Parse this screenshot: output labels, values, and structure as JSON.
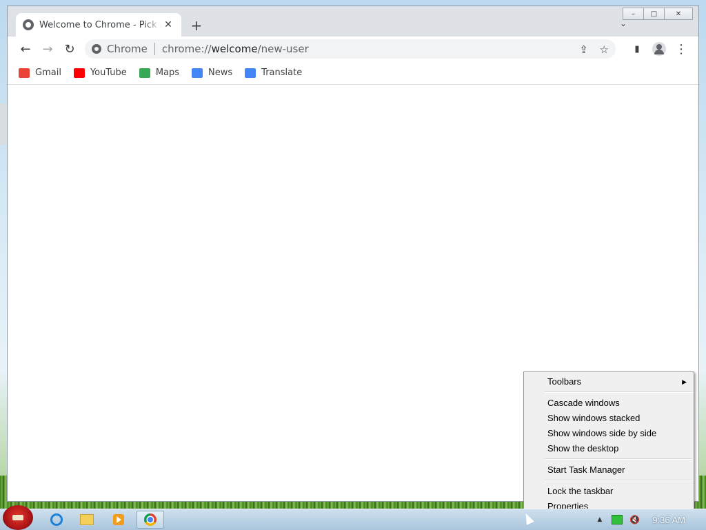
{
  "browser": {
    "tab": {
      "title": "Welcome to Chrome - Pick a b",
      "close": "✕",
      "icon": "chrome-page-icon"
    },
    "new_tab": "+",
    "tab_search": "⌄",
    "window_controls": {
      "minimize": "–",
      "maximize": "□",
      "close": "✕"
    },
    "nav": {
      "back": "←",
      "forward": "→",
      "reload": "↻"
    },
    "omnibox": {
      "chip": "Chrome",
      "url_scheme": "chrome://",
      "url_host": "welcome",
      "url_path": "/new-user"
    },
    "toolbar_icons": {
      "share": "⇪",
      "bookmark": "☆",
      "side_panel": "▮",
      "menu": "⋮"
    },
    "bookmarks": [
      {
        "label": "Gmail",
        "color": "#ea4335"
      },
      {
        "label": "YouTube",
        "color": "#ff0000"
      },
      {
        "label": "Maps",
        "color": "#34a853"
      },
      {
        "label": "News",
        "color": "#4285f4"
      },
      {
        "label": "Translate",
        "color": "#4285f4"
      }
    ]
  },
  "context_menu": {
    "items": [
      {
        "label": "Toolbars",
        "submenu": true
      },
      {
        "label": "Cascade windows"
      },
      {
        "label": "Show windows stacked"
      },
      {
        "label": "Show windows side by side"
      },
      {
        "label": "Show the desktop"
      },
      {
        "label": "Start Task Manager"
      },
      {
        "label": "Lock the taskbar"
      },
      {
        "label": "Properties"
      }
    ],
    "submenu_arrow": "▶"
  },
  "taskbar": {
    "clock": "9:36 AM",
    "tray_arrow": "▲",
    "volume": "🔇"
  }
}
